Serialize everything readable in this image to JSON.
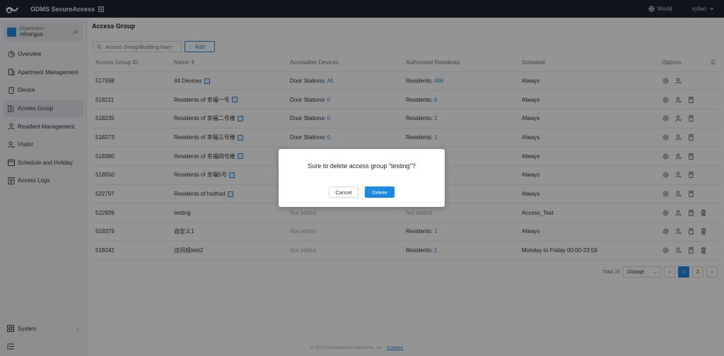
{
  "topbar": {
    "brand": "GDMS SecureAccess",
    "region": "World",
    "user": "xyliao"
  },
  "org": {
    "label": "Organization",
    "name": "mhongus"
  },
  "sidebar": {
    "items": [
      {
        "label": "Overview"
      },
      {
        "label": "Apartment Management"
      },
      {
        "label": "Device"
      },
      {
        "label": "Access Group"
      },
      {
        "label": "Resident Management"
      },
      {
        "label": "Visitor"
      },
      {
        "label": "Schedule and Holiday"
      },
      {
        "label": "Access Logs"
      }
    ],
    "system": "System"
  },
  "main": {
    "title": "Access Group",
    "search_placeholder": "Access Group/Building Nam",
    "add_label": "Add",
    "columns": [
      "Access Group ID",
      "Name",
      "Accessible Devices",
      "Authorized Residents",
      "Schedule",
      "Options"
    ],
    "rows": [
      {
        "id": "517598",
        "name": "All Devices",
        "badge": true,
        "dev_prefix": "Door Stations: ",
        "dev_val": "All",
        "res_prefix": "Residents: ",
        "res_val": "496",
        "schedule": "Always",
        "delete": false
      },
      {
        "id": "518211",
        "name": "Residents of 幸福一号",
        "badge": true,
        "dev_prefix": "Door Stations: ",
        "dev_val": "0",
        "res_prefix": "Residents: ",
        "res_val": "6",
        "schedule": "Always",
        "delete": false
      },
      {
        "id": "518235",
        "name": "Residents of 幸福二号楼",
        "badge": true,
        "dev_prefix": "Door Stations: ",
        "dev_val": "0",
        "res_prefix": "Residents: ",
        "res_val": "2",
        "schedule": "Always",
        "delete": false
      },
      {
        "id": "518273",
        "name": "Residents of 幸福三号楼",
        "badge": true,
        "dev_prefix": "Door Stations: ",
        "dev_val": "0",
        "res_prefix": "Residents: ",
        "res_val": "1",
        "schedule": "Always",
        "delete": false
      },
      {
        "id": "518380",
        "name": "Residents of 幸福四号楼",
        "badge": true,
        "dev_prefix": "",
        "dev_val": "",
        "res_prefix": "",
        "res_val": "",
        "schedule": "Always",
        "delete": false
      },
      {
        "id": "518550",
        "name": "Residents of 幸福5号",
        "badge": true,
        "dev_prefix": "",
        "dev_val": "",
        "res_prefix": "",
        "res_val": "",
        "schedule": "Always",
        "delete": false
      },
      {
        "id": "522797",
        "name": "Residents of hsdhsd",
        "badge": true,
        "dev_prefix": "",
        "dev_val": "",
        "res_prefix": "",
        "res_val": "",
        "schedule": "Always",
        "delete": false
      },
      {
        "id": "522939",
        "name": "testing",
        "badge": false,
        "dev_muted": "Not added",
        "res_muted": "Not added",
        "schedule": "Access_Test",
        "delete": true
      },
      {
        "id": "518379",
        "name": "自定义1",
        "badge": false,
        "dev_muted": "Not added",
        "res_prefix": "Residents: ",
        "res_val": "1",
        "schedule": "Always",
        "delete": true
      },
      {
        "id": "518242",
        "name": "访问组test2",
        "badge": false,
        "dev_muted": "Not added",
        "res_prefix": "Residents: ",
        "res_val": "1",
        "schedule": "Monday to Friday 00:00-23:59",
        "delete": true
      }
    ]
  },
  "pagination": {
    "total": "Total 15",
    "page_size": "10/page",
    "pages": [
      "1",
      "2"
    ],
    "current": "1"
  },
  "footer": {
    "copyright": "© 2025 Grandstream Networks, Inc.",
    "cookies": "Cookies"
  },
  "dialog": {
    "message": "Sure to delete access group \"testing\"?",
    "cancel": "Cancel",
    "delete": "Delete"
  },
  "colors": {
    "accent": "#1e88e5",
    "topbar": "#1c2333"
  }
}
